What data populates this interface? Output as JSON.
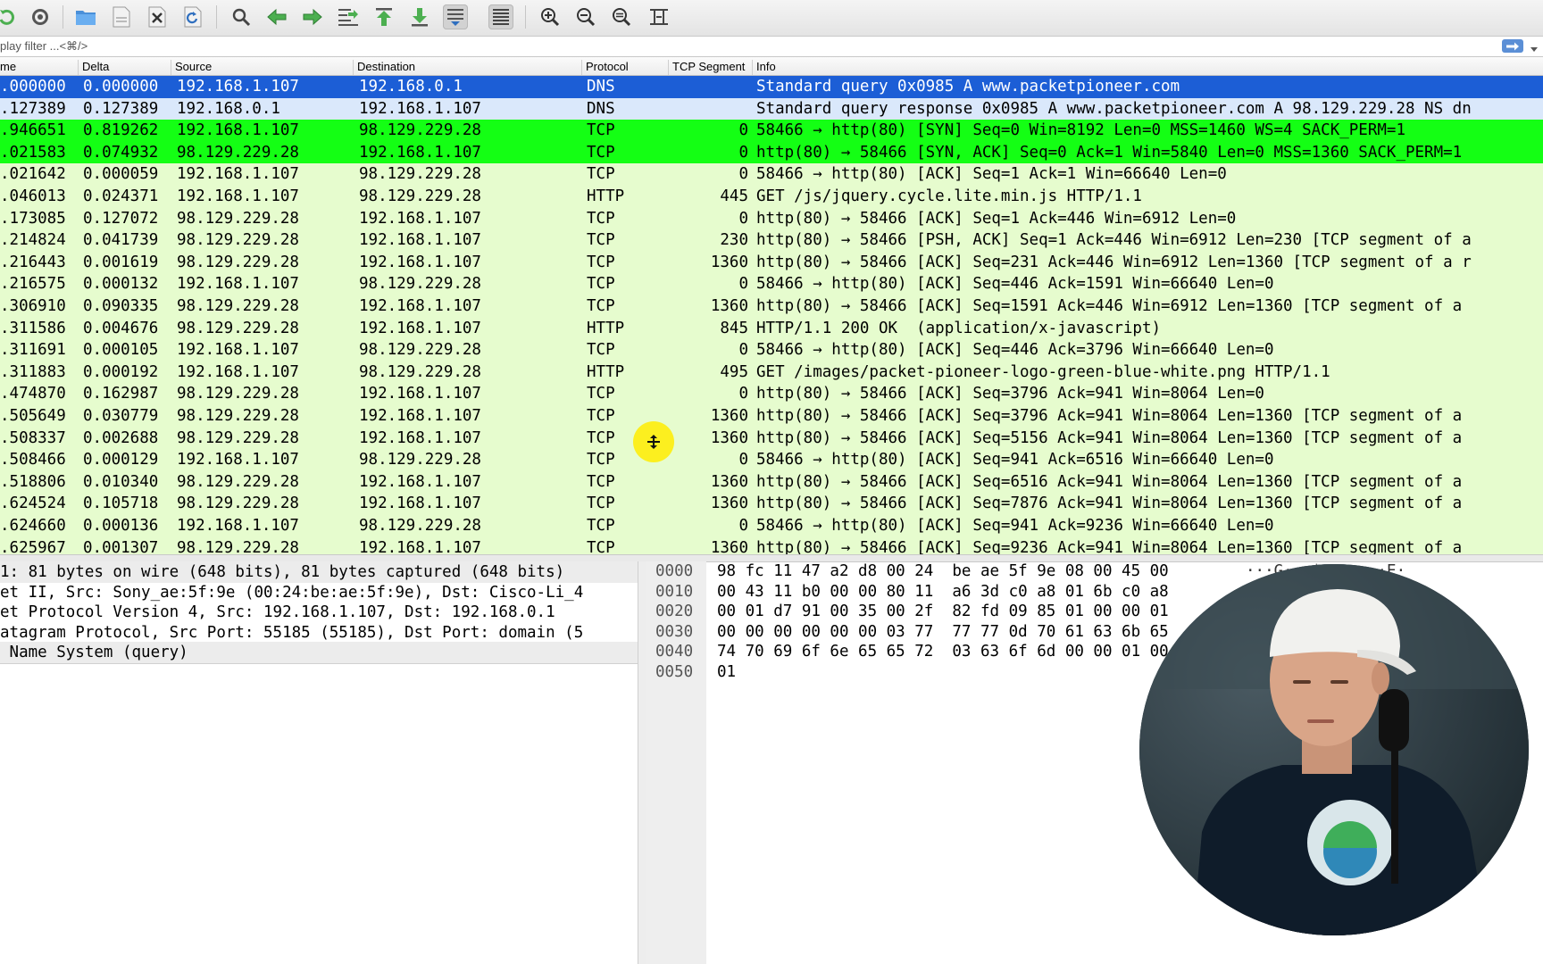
{
  "toolbar": {
    "icons": [
      "capture-restart-icon",
      "capture-options-icon",
      "open-folder-icon",
      "save-file-icon",
      "close-file-icon",
      "reload-icon",
      "find-icon",
      "go-back-icon",
      "go-forward-icon",
      "go-to-packet-icon",
      "first-packet-icon",
      "last-packet-icon",
      "autoscroll-icon",
      "colorize-icon",
      "zoom-in-icon",
      "zoom-out-icon",
      "zoom-normal-icon",
      "resize-columns-icon"
    ]
  },
  "filter": {
    "placeholder": "play filter ...<⌘/>"
  },
  "columns": {
    "time": "me",
    "delta": "Delta",
    "source": "Source",
    "destination": "Destination",
    "protocol": "Protocol",
    "tcp_segment": "TCP Segment",
    "info": "Info"
  },
  "packets": [
    {
      "time": ".000000",
      "delta": "0.000000",
      "src": "192.168.1.107",
      "dst": "192.168.0.1",
      "proto": "DNS",
      "seg": "",
      "info": "Standard query 0x0985 A www.packetpioneer.com",
      "color": "sel"
    },
    {
      "time": ".127389",
      "delta": "0.127389",
      "src": "192.168.0.1",
      "dst": "192.168.1.107",
      "proto": "DNS",
      "seg": "",
      "info": "Standard query response 0x0985 A www.packetpioneer.com A 98.129.229.28 NS dn",
      "color": "dns"
    },
    {
      "time": ".946651",
      "delta": "0.819262",
      "src": "192.168.1.107",
      "dst": "98.129.229.28",
      "proto": "TCP",
      "seg": "0",
      "info": "58466 → http(80) [SYN] Seq=0 Win=8192 Len=0 MSS=1460 WS=4 SACK_PERM=1",
      "color": "syn"
    },
    {
      "time": ".021583",
      "delta": "0.074932",
      "src": "98.129.229.28",
      "dst": "192.168.1.107",
      "proto": "TCP",
      "seg": "0",
      "info": "http(80) → 58466 [SYN, ACK] Seq=0 Ack=1 Win=5840 Len=0 MSS=1360 SACK_PERM=1",
      "color": "syn"
    },
    {
      "time": ".021642",
      "delta": "0.000059",
      "src": "192.168.1.107",
      "dst": "98.129.229.28",
      "proto": "TCP",
      "seg": "0",
      "info": "58466 → http(80) [ACK] Seq=1 Ack=1 Win=66640 Len=0",
      "color": "tcp"
    },
    {
      "time": ".046013",
      "delta": "0.024371",
      "src": "192.168.1.107",
      "dst": "98.129.229.28",
      "proto": "HTTP",
      "seg": "445",
      "info": "GET /js/jquery.cycle.lite.min.js HTTP/1.1",
      "color": "tcp"
    },
    {
      "time": ".173085",
      "delta": "0.127072",
      "src": "98.129.229.28",
      "dst": "192.168.1.107",
      "proto": "TCP",
      "seg": "0",
      "info": "http(80) → 58466 [ACK] Seq=1 Ack=446 Win=6912 Len=0",
      "color": "tcp"
    },
    {
      "time": ".214824",
      "delta": "0.041739",
      "src": "98.129.229.28",
      "dst": "192.168.1.107",
      "proto": "TCP",
      "seg": "230",
      "info": "http(80) → 58466 [PSH, ACK] Seq=1 Ack=446 Win=6912 Len=230 [TCP segment of a",
      "color": "tcp"
    },
    {
      "time": ".216443",
      "delta": "0.001619",
      "src": "98.129.229.28",
      "dst": "192.168.1.107",
      "proto": "TCP",
      "seg": "1360",
      "info": "http(80) → 58466 [ACK] Seq=231 Ack=446 Win=6912 Len=1360 [TCP segment of a r",
      "color": "tcp"
    },
    {
      "time": ".216575",
      "delta": "0.000132",
      "src": "192.168.1.107",
      "dst": "98.129.229.28",
      "proto": "TCP",
      "seg": "0",
      "info": "58466 → http(80) [ACK] Seq=446 Ack=1591 Win=66640 Len=0",
      "color": "tcp"
    },
    {
      "time": ".306910",
      "delta": "0.090335",
      "src": "98.129.229.28",
      "dst": "192.168.1.107",
      "proto": "TCP",
      "seg": "1360",
      "info": "http(80) → 58466 [ACK] Seq=1591 Ack=446 Win=6912 Len=1360 [TCP segment of a",
      "color": "tcp"
    },
    {
      "time": ".311586",
      "delta": "0.004676",
      "src": "98.129.229.28",
      "dst": "192.168.1.107",
      "proto": "HTTP",
      "seg": "845",
      "info": "HTTP/1.1 200 OK  (application/x-javascript)",
      "color": "tcp"
    },
    {
      "time": ".311691",
      "delta": "0.000105",
      "src": "192.168.1.107",
      "dst": "98.129.229.28",
      "proto": "TCP",
      "seg": "0",
      "info": "58466 → http(80) [ACK] Seq=446 Ack=3796 Win=66640 Len=0",
      "color": "tcp"
    },
    {
      "time": ".311883",
      "delta": "0.000192",
      "src": "192.168.1.107",
      "dst": "98.129.229.28",
      "proto": "HTTP",
      "seg": "495",
      "info": "GET /images/packet-pioneer-logo-green-blue-white.png HTTP/1.1",
      "color": "tcp"
    },
    {
      "time": ".474870",
      "delta": "0.162987",
      "src": "98.129.229.28",
      "dst": "192.168.1.107",
      "proto": "TCP",
      "seg": "0",
      "info": "http(80) → 58466 [ACK] Seq=3796 Ack=941 Win=8064 Len=0",
      "color": "tcp"
    },
    {
      "time": ".505649",
      "delta": "0.030779",
      "src": "98.129.229.28",
      "dst": "192.168.1.107",
      "proto": "TCP",
      "seg": "1360",
      "info": "http(80) → 58466 [ACK] Seq=3796 Ack=941 Win=8064 Len=1360 [TCP segment of a",
      "color": "tcp"
    },
    {
      "time": ".508337",
      "delta": "0.002688",
      "src": "98.129.229.28",
      "dst": "192.168.1.107",
      "proto": "TCP",
      "seg": "1360",
      "info": "http(80) → 58466 [ACK] Seq=5156 Ack=941 Win=8064 Len=1360 [TCP segment of a",
      "color": "tcp"
    },
    {
      "time": ".508466",
      "delta": "0.000129",
      "src": "192.168.1.107",
      "dst": "98.129.229.28",
      "proto": "TCP",
      "seg": "0",
      "info": "58466 → http(80) [ACK] Seq=941 Ack=6516 Win=66640 Len=0",
      "color": "tcp"
    },
    {
      "time": ".518806",
      "delta": "0.010340",
      "src": "98.129.229.28",
      "dst": "192.168.1.107",
      "proto": "TCP",
      "seg": "1360",
      "info": "http(80) → 58466 [ACK] Seq=6516 Ack=941 Win=8064 Len=1360 [TCP segment of a",
      "color": "tcp"
    },
    {
      "time": ".624524",
      "delta": "0.105718",
      "src": "98.129.229.28",
      "dst": "192.168.1.107",
      "proto": "TCP",
      "seg": "1360",
      "info": "http(80) → 58466 [ACK] Seq=7876 Ack=941 Win=8064 Len=1360 [TCP segment of a",
      "color": "tcp"
    },
    {
      "time": ".624660",
      "delta": "0.000136",
      "src": "192.168.1.107",
      "dst": "98.129.229.28",
      "proto": "TCP",
      "seg": "0",
      "info": "58466 → http(80) [ACK] Seq=941 Ack=9236 Win=66640 Len=0",
      "color": "tcp"
    },
    {
      "time": ".625967",
      "delta": "0.001307",
      "src": "98.129.229.28",
      "dst": "192.168.1.107",
      "proto": "TCP",
      "seg": "1360",
      "info": "http(80) → 58466 [ACK] Seq=9236 Ack=941 Win=8064 Len=1360 [TCP segment of a",
      "color": "tcp"
    }
  ],
  "details": [
    "1: 81 bytes on wire (648 bits), 81 bytes captured (648 bits)",
    "et II, Src: Sony_ae:5f:9e (00:24:be:ae:5f:9e), Dst: Cisco-Li_4",
    "et Protocol Version 4, Src: 192.168.1.107, Dst: 192.168.0.1",
    "atagram Protocol, Src Port: 55185 (55185), Dst Port: domain (5",
    " Name System (query)"
  ],
  "bytes": [
    {
      "off": "0000",
      "hex": "98 fc 11 47 a2 d8 00 24  be ae 5f 9e 08 00 45 00",
      "asc": "···G···$ ··_···E·"
    },
    {
      "off": "0010",
      "hex": "00 43 11 b0 00 00 80 11  a6 3d c0 a8 01 6b c0 a8",
      "asc": ""
    },
    {
      "off": "0020",
      "hex": "00 01 d7 91 00 35 00 2f  82 fd 09 85 01 00 00 01",
      "asc": ""
    },
    {
      "off": "0030",
      "hex": "00 00 00 00 00 00 03 77  77 77 0d 70 61 63 6b 65",
      "asc": ""
    },
    {
      "off": "0040",
      "hex": "74 70 69 6f 6e 65 65 72  03 63 6f 6d 00 00 01 00",
      "asc": ""
    },
    {
      "off": "0050",
      "hex": "01",
      "asc": ""
    }
  ],
  "colors": {
    "selected": "#1c5ed6",
    "dns": "#dae8fb",
    "tcp_syn": "#14ff14",
    "tcp": "#e6fcce"
  }
}
